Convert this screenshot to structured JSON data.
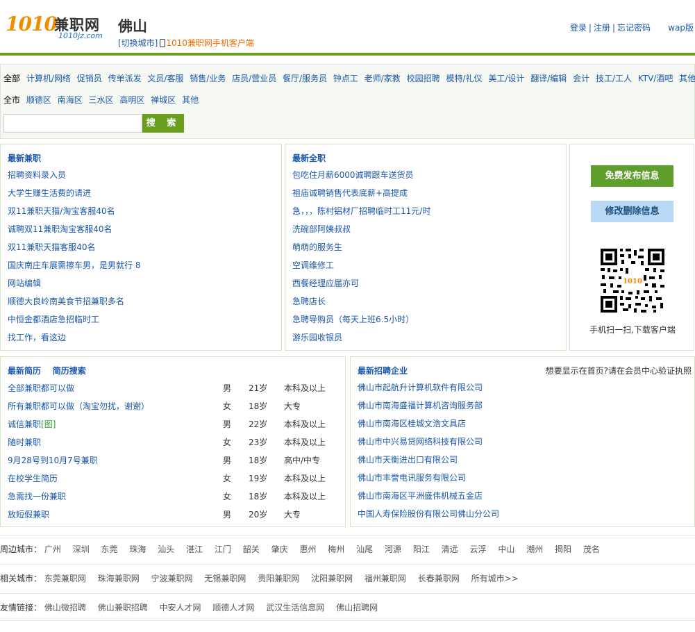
{
  "header": {
    "logo_num": "1010",
    "logo_cn": "兼职网",
    "logo_domain": "1010jz.com",
    "city": "佛山",
    "switch_city": "[切换城市]",
    "mobile_client": "1010兼职网手机客户端",
    "login": "登录",
    "register": "注册",
    "forgot": "忘记密码",
    "sep": "|",
    "wap": "wap版"
  },
  "filter": {
    "categories": [
      "全部",
      "计算机/网络",
      "促销员",
      "传单派发",
      "文员/客服",
      "销售/业务",
      "店员/营业员",
      "餐厅/服务员",
      "钟点工",
      "老师/家教",
      "校园招聘",
      "模特/礼仪",
      "美工/设计",
      "翻译/编辑",
      "会计",
      "技工/工人",
      "KTV/酒吧",
      "其他"
    ],
    "districts": [
      "全市",
      "顺德区",
      "南海区",
      "三水区",
      "高明区",
      "禅城区",
      "其他"
    ],
    "search_button": "搜 索",
    "search_value": ""
  },
  "latest_parttime": {
    "title": "最新兼职",
    "items": [
      "招聘资料录入员",
      "大学生赚生活费的请进",
      "双11兼职天猫/淘宝客服40名",
      "诚聘双11兼职淘宝客服40名",
      "双11兼职天猫客服40名",
      "国庆南庄车展需擦车男，是男就行 8",
      "网站编辑",
      "顺德大良岭南美食节招兼职多名",
      "中恒金都酒店急招临时工",
      "找工作，看这边"
    ]
  },
  "latest_fulltime": {
    "title": "最新全职",
    "items": [
      "包吃住月薪6000诚聘跟车送货员",
      "祖庙诚聘销售代表底薪+高提成",
      "急，，，陈村铝材厂招聘临时工11元/时",
      "洗碗部阿姨叔叔",
      "萌萌的服务生",
      "空调维修工",
      "西餐经理应届亦可",
      "急聘店长",
      "急聘导购员（每天上班6.5小时）",
      "游乐园收银员"
    ]
  },
  "side": {
    "publish": "免费发布信息",
    "modify": "修改删除信息",
    "qr_caption": "手机扫一扫,下载客户端",
    "qr_logo": "1010"
  },
  "resumes": {
    "title": "最新简历",
    "search_link": "简历搜索",
    "rows": [
      {
        "title": "全部兼职都可以做",
        "tag": "",
        "gender": "男",
        "age": "21岁",
        "edu": "本科及以上"
      },
      {
        "title": "所有兼职都可以做（淘宝勿扰，谢谢）",
        "tag": "",
        "gender": "女",
        "age": "18岁",
        "edu": "大专"
      },
      {
        "title": "诚信兼职",
        "tag": "[图]",
        "gender": "男",
        "age": "22岁",
        "edu": "本科及以上"
      },
      {
        "title": "随时兼职",
        "tag": "",
        "gender": "女",
        "age": "23岁",
        "edu": "本科及以上"
      },
      {
        "title": "9月28号到10月7号兼职",
        "tag": "",
        "gender": "男",
        "age": "18岁",
        "edu": "高中/中专"
      },
      {
        "title": "在校学生简历",
        "tag": "",
        "gender": "女",
        "age": "19岁",
        "edu": "本科及以上"
      },
      {
        "title": "急需找一份兼职",
        "tag": "",
        "gender": "女",
        "age": "18岁",
        "edu": "本科及以上"
      },
      {
        "title": "放短假兼职",
        "tag": "",
        "gender": "男",
        "age": "20岁",
        "edu": "大专"
      }
    ]
  },
  "companies": {
    "title": "最新招聘企业",
    "note": "想要显示在首页?请在会员中心验证执照",
    "items": [
      "佛山市起航升计算机软件有限公司",
      "佛山市南海盛福计算机咨询服务部",
      "佛山市南海区桂城文浩文具店",
      "佛山市中兴易贷网络科技有限公司",
      "佛山市天衡进出口有限公司",
      "佛山市丰誉电讯服务有限公司",
      "佛山市南海区平洲盛伟机械五金店",
      "中国人寿保险股份有限公司佛山分公司"
    ]
  },
  "footer": {
    "nearby_label": "周边城市：",
    "nearby": [
      "广州",
      "深圳",
      "东莞",
      "珠海",
      "汕头",
      "湛江",
      "江门",
      "韶关",
      "肇庆",
      "惠州",
      "梅州",
      "汕尾",
      "河源",
      "阳江",
      "清远",
      "云浮",
      "中山",
      "潮州",
      "揭阳",
      "茂名"
    ],
    "related_label": "相关城市：",
    "related": [
      "东莞兼职网",
      "珠海兼职网",
      "宁波兼职网",
      "无锡兼职网",
      "贵阳兼职网",
      "沈阳兼职网",
      "福州兼职网",
      "长春兼职网",
      "所有城市>>"
    ],
    "friends_label": "友情链接：",
    "friends": [
      "佛山微招聘",
      "佛山兼职招聘",
      "中安人才网",
      "顺德人才网",
      "武汉生活信息网",
      "佛山招聘网"
    ]
  },
  "colors": {
    "brand_green": "#6a9f1e",
    "link_blue": "#1a57a8",
    "logo_orange": "#f08c00"
  }
}
